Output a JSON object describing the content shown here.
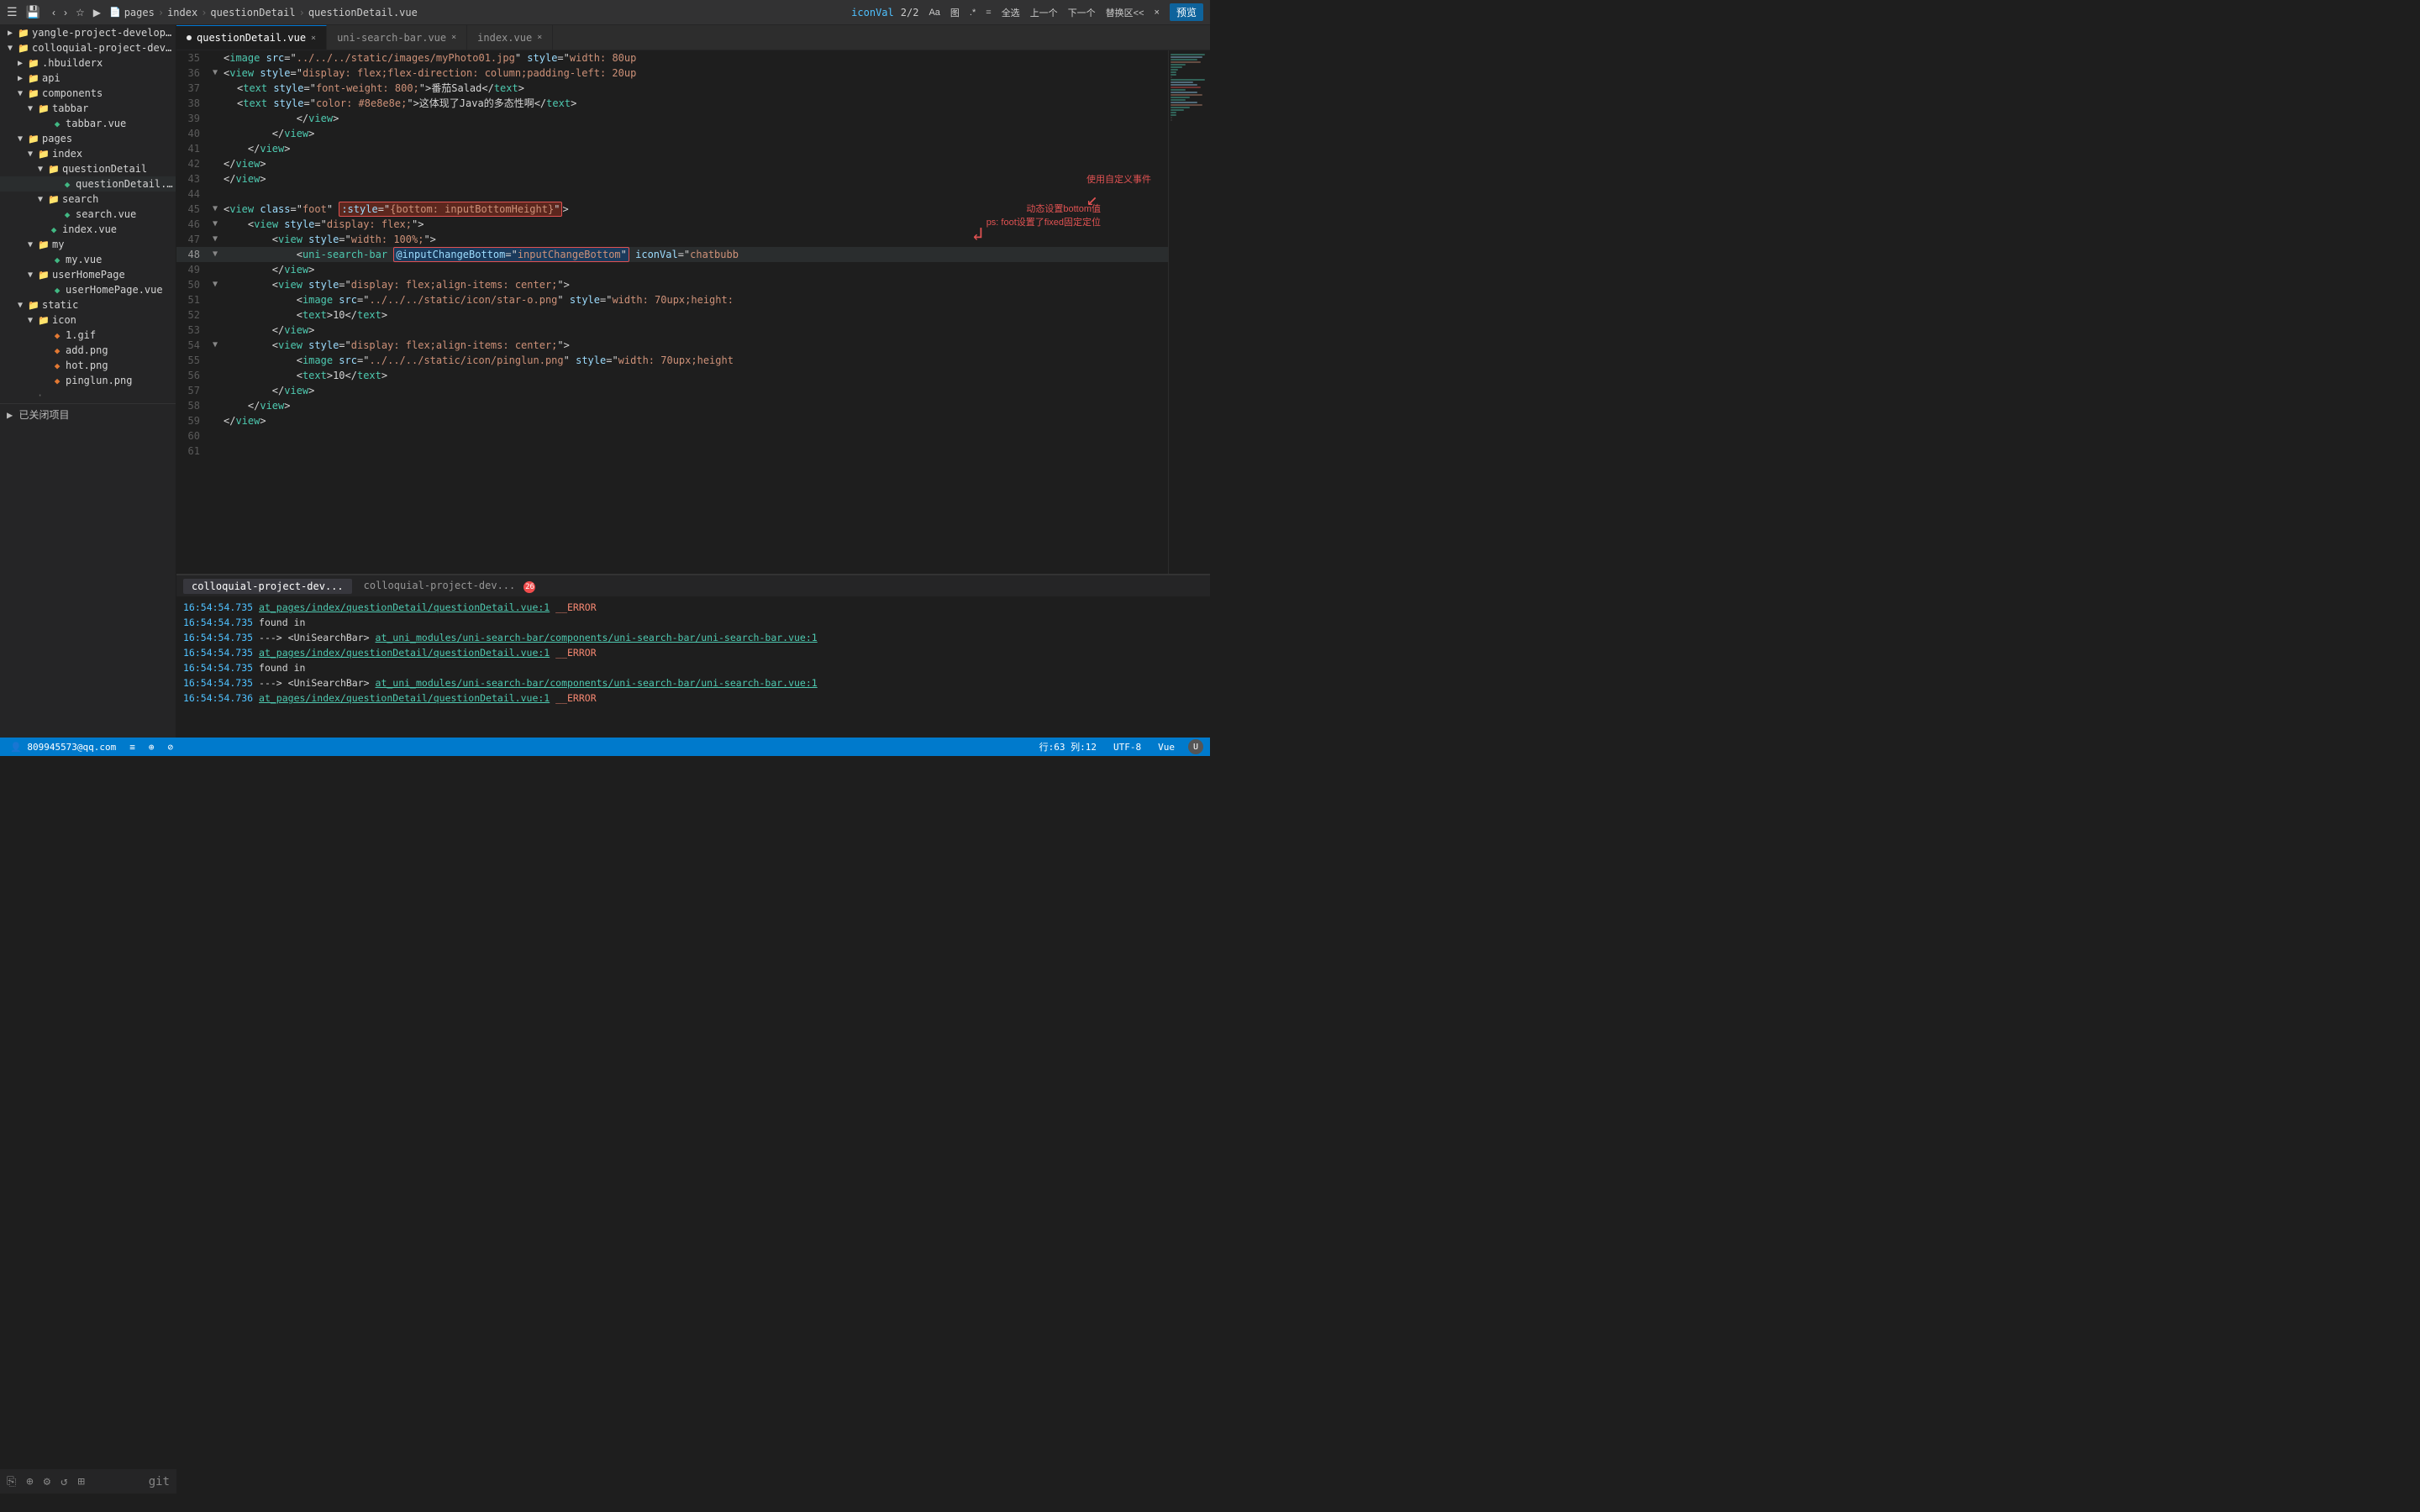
{
  "titleBar": {
    "breadcrumbs": [
      "pages",
      "index",
      "questionDetail",
      "questionDetail.vue"
    ],
    "searchLabel": "iconVal",
    "pageCount": "2/2",
    "buttons": [
      "Aa",
      "图",
      ".*",
      "=",
      "全选",
      "上一个",
      "下一个",
      "替换区<<",
      "×"
    ],
    "previewLabel": "预览"
  },
  "sidebar": {
    "projects": [
      {
        "name": "yangle-project-development-uniapp",
        "expanded": false,
        "depth": 0
      },
      {
        "name": "colloquial-project-development-uniapp",
        "expanded": true,
        "depth": 0
      }
    ],
    "tree": [
      {
        "depth": 1,
        "type": "folder",
        "name": ".hbuilderx",
        "expanded": false
      },
      {
        "depth": 1,
        "type": "folder",
        "name": "api",
        "expanded": false
      },
      {
        "depth": 1,
        "type": "folder",
        "name": "components",
        "expanded": true
      },
      {
        "depth": 2,
        "type": "folder",
        "name": "tabbar",
        "expanded": true
      },
      {
        "depth": 3,
        "type": "file-vue",
        "name": "tabbar.vue"
      },
      {
        "depth": 1,
        "type": "folder",
        "name": "pages",
        "expanded": true
      },
      {
        "depth": 2,
        "type": "folder",
        "name": "index",
        "expanded": true
      },
      {
        "depth": 3,
        "type": "folder",
        "name": "questionDetail",
        "expanded": true
      },
      {
        "depth": 4,
        "type": "file-vue",
        "name": "questionDetail.vue"
      },
      {
        "depth": 3,
        "type": "folder",
        "name": "search",
        "expanded": true
      },
      {
        "depth": 4,
        "type": "file-vue",
        "name": "search.vue"
      },
      {
        "depth": 3,
        "type": "file-vue",
        "name": "index.vue"
      },
      {
        "depth": 2,
        "type": "folder",
        "name": "my",
        "expanded": true
      },
      {
        "depth": 3,
        "type": "file-vue",
        "name": "my.vue"
      },
      {
        "depth": 2,
        "type": "folder",
        "name": "userHomePage",
        "expanded": true
      },
      {
        "depth": 3,
        "type": "file-vue",
        "name": "userHomePage.vue"
      },
      {
        "depth": 1,
        "type": "folder",
        "name": "static",
        "expanded": true
      },
      {
        "depth": 2,
        "type": "folder",
        "name": "icon",
        "expanded": true
      },
      {
        "depth": 3,
        "type": "file-gif",
        "name": "1.gif"
      },
      {
        "depth": 3,
        "type": "file-png",
        "name": "add.png"
      },
      {
        "depth": 3,
        "type": "file-png",
        "name": "hot.png"
      },
      {
        "depth": 3,
        "type": "file-png",
        "name": "pinglun.png"
      }
    ],
    "closedProjects": "已关闭项目"
  },
  "tabs": [
    {
      "label": "questionDetail.vue",
      "active": true,
      "modified": true
    },
    {
      "label": "uni-search-bar.vue",
      "active": false,
      "modified": false
    },
    {
      "label": "index.vue",
      "active": false,
      "modified": false
    }
  ],
  "codeLines": [
    {
      "num": 35,
      "fold": false,
      "content": "            <image src=\"../../../static/images/myPhoto01.jpg\" style=\"width: 80up"
    },
    {
      "num": 36,
      "fold": true,
      "content": "            <view style=\"display: flex;flex-direction: column;padding-left: 20up"
    },
    {
      "num": 37,
      "fold": false,
      "content": "                <text style=\"font-weight: 800;\">番茄Salad</text>"
    },
    {
      "num": 38,
      "fold": false,
      "content": "                <text style=\"color: #8e8e8e;\">这体现了Java的多态性啊</text>"
    },
    {
      "num": 39,
      "fold": false,
      "content": "            </view>"
    },
    {
      "num": 40,
      "fold": false,
      "content": "        </view>"
    },
    {
      "num": 41,
      "fold": false,
      "content": "    </view>"
    },
    {
      "num": 42,
      "fold": false,
      "content": "</view>"
    },
    {
      "num": 43,
      "fold": false,
      "content": "</view>"
    },
    {
      "num": 44,
      "fold": false,
      "content": ""
    },
    {
      "num": 45,
      "fold": true,
      "content": "<view class=\"foot\" :style=\"{bottom: inputBottomHeight}\">",
      "hasRedBox1": true
    },
    {
      "num": 46,
      "fold": true,
      "content": "    <view style=\"display: flex;\">"
    },
    {
      "num": 47,
      "fold": true,
      "content": "        <view style=\"width: 100%;\">"
    },
    {
      "num": 48,
      "fold": true,
      "content": "            <uni-search-bar @inputChangeBottom=\"inputChangeBottom\" iconVal=\"chatbubb",
      "hasRedBox2": true
    },
    {
      "num": 49,
      "fold": false,
      "content": "        </view>"
    },
    {
      "num": 50,
      "fold": true,
      "content": "        <view style=\"display: flex;align-items: center;\">"
    },
    {
      "num": 51,
      "fold": false,
      "content": "            <image src=\"../../../static/icon/star-o.png\" style=\"width: 70upx;height:"
    },
    {
      "num": 52,
      "fold": false,
      "content": "            <text>10</text>"
    },
    {
      "num": 53,
      "fold": false,
      "content": "        </view>"
    },
    {
      "num": 54,
      "fold": true,
      "content": "        <view style=\"display: flex;align-items: center;\">"
    },
    {
      "num": 55,
      "fold": false,
      "content": "            <image src=\"../../../static/icon/pinglun.png\" style=\"width: 70upx;height"
    },
    {
      "num": 56,
      "fold": false,
      "content": "            <text>10</text>"
    },
    {
      "num": 57,
      "fold": false,
      "content": "        </view>"
    },
    {
      "num": 58,
      "fold": false,
      "content": "    </view>"
    },
    {
      "num": 59,
      "fold": false,
      "content": "</view>"
    },
    {
      "num": 60,
      "fold": false,
      "content": ""
    },
    {
      "num": 61,
      "fold": false,
      "content": ""
    }
  ],
  "annotations": {
    "text1": "动态设置bottom值",
    "text2": "ps: foot设置了fixed固定定位",
    "text3": "使用自定义事件",
    "redBox1Label": ":style=\"{bottom: inputBottomHeight}\"",
    "redBox2Label": "@inputChangeBottom=\"inputChangeBottom\""
  },
  "terminal": {
    "tabs": [
      "colloquial-project-dev...",
      "colloquial-project-dev..."
    ],
    "badge": "26",
    "lines": [
      {
        "time": "16:54:54.735",
        "link": "at_pages/index/questionDetail/questionDetail.vue:1",
        "rest": " __ERROR"
      },
      {
        "time": "16:54:54.735",
        "text": "found in"
      },
      {
        "time": "16:54:54.735",
        "arrow": "---> <UniSearchBar>",
        "link": "at_uni_modules/uni-search-bar/components/uni-search-bar/uni-search-bar.vue:1",
        "rest": ""
      },
      {
        "time": "16:54:54.735",
        "link2": "at_pages/index/questionDetail/questionDetail.vue:1",
        "rest2": " __ERROR"
      },
      {
        "time": "16:54:54.735",
        "text": "found in"
      },
      {
        "time": "16:54:54.735",
        "arrow": "---> <UniSearchBar>",
        "link": "at_uni_modules/uni-search-bar/components/uni-search-bar/uni-search-bar.vue:1",
        "rest": ""
      },
      {
        "time": "16:54:54.736",
        "link": "at_pages/index/questionDetail/questionDetail.vue:1",
        "rest": " __ERROR"
      }
    ]
  },
  "statusBar": {
    "email": "809945573@qq.com",
    "position": "行:63  列:12",
    "encoding": "UTF-8",
    "language": "Vue"
  }
}
